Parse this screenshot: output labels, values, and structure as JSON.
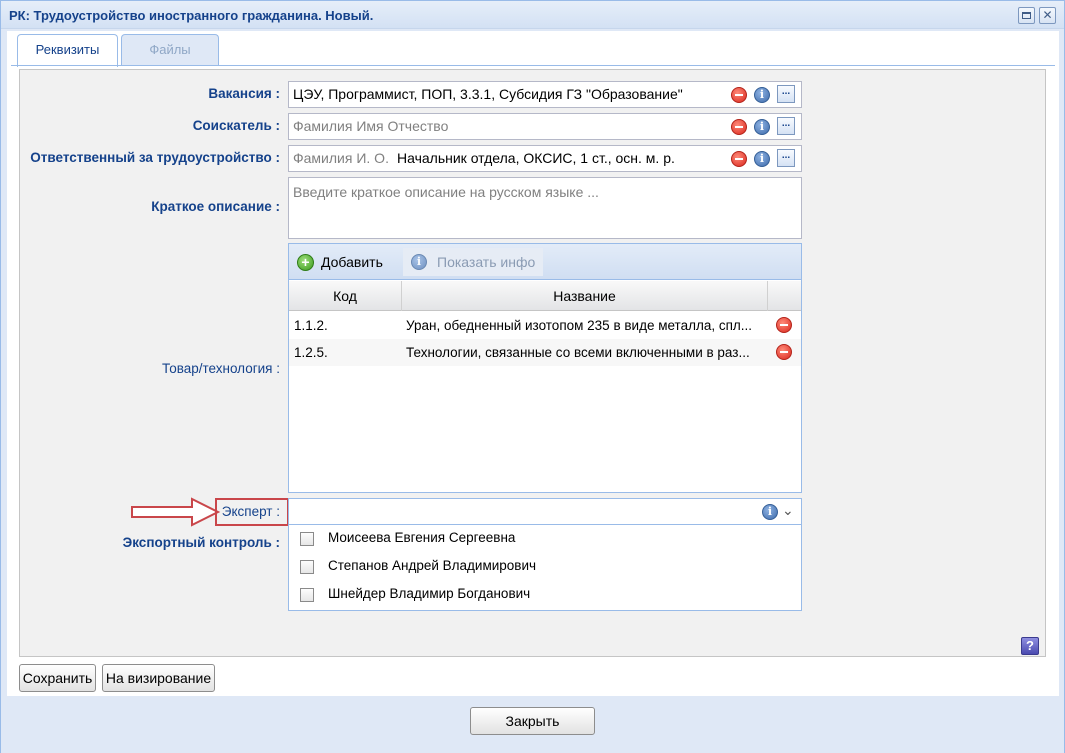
{
  "window": {
    "title": "РК: Трудоустройство иностранного гражданина. Новый.",
    "maximize_icon": "maximize-icon",
    "close_icon": "close-icon"
  },
  "tabs": [
    {
      "label": "Реквизиты",
      "active": true
    },
    {
      "label": "Файлы",
      "active": false
    }
  ],
  "form": {
    "vacancy": {
      "label": "Вакансия :",
      "value": "ЦЭУ, Программист, ПОП, 3.3.1, Субсидия ГЗ \"Образование\""
    },
    "applicant": {
      "label": "Соискатель :",
      "placeholder": "Фамилия Имя Отчество"
    },
    "responsible": {
      "label": "Ответственный за трудоустройство :",
      "placeholder": "Фамилия И. О.",
      "value": "Начальник отдела, ОКСИС, 1 ст., осн. м. р."
    },
    "description": {
      "label": "Краткое описание :",
      "placeholder": "Введите краткое описание на русском языке ..."
    },
    "goods": {
      "label": "Товар/технология :",
      "toolbar": {
        "add_label": "Добавить",
        "info_label": "Показать инфо"
      },
      "columns": [
        "Код",
        "Название"
      ],
      "rows": [
        {
          "code": "1.1.2.",
          "name": "Уран, обедненный изотопом 235 в виде металла, спл..."
        },
        {
          "code": "1.2.5.",
          "name": "Технологии, связанные со всеми включенными в раз..."
        }
      ]
    },
    "expert": {
      "label": "Эксперт :",
      "value": "",
      "options": [
        {
          "label": "Моисеева Евгения Сергеевна",
          "checked": false
        },
        {
          "label": "Степанов Андрей Владимирович",
          "checked": false
        },
        {
          "label": "Шнейдер Владимир Богданович",
          "checked": false
        }
      ]
    },
    "export_control": {
      "label": "Экспортный контроль :"
    }
  },
  "actions": {
    "save": "Сохранить",
    "send": "На визирование",
    "help": "?",
    "close": "Закрыть"
  },
  "colors": {
    "label_blue": "#15428b",
    "highlight_red": "#c9464a",
    "frame_blue": "#99bbe8"
  }
}
